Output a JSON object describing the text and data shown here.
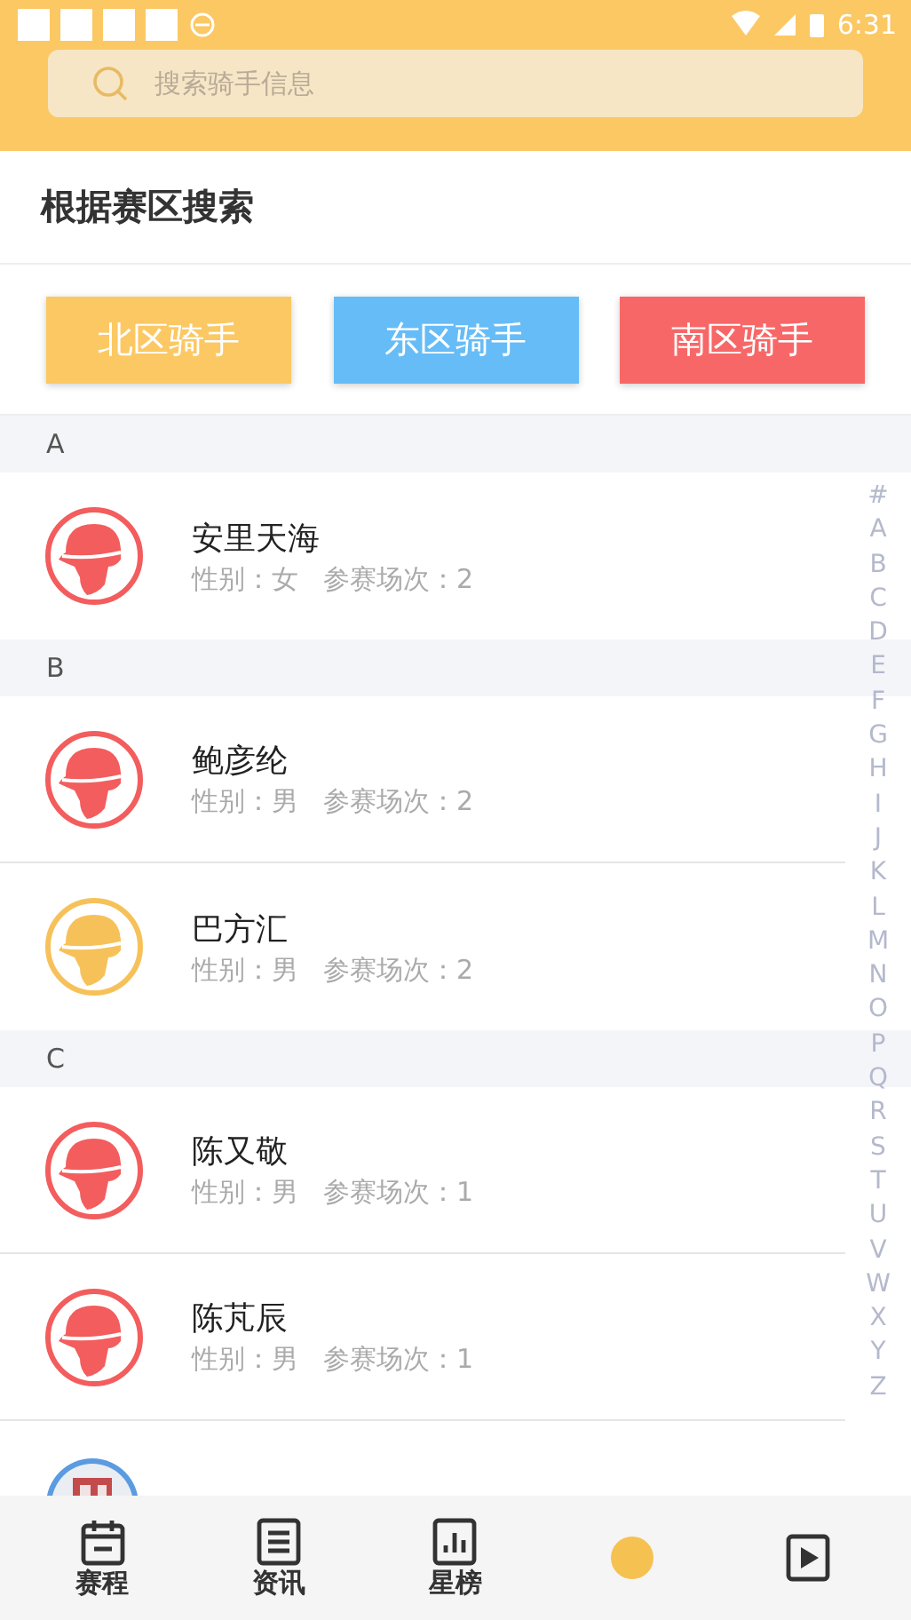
{
  "status_bar": {
    "time": "6:31"
  },
  "search": {
    "placeholder": "搜索骑手信息"
  },
  "section_title": "根据赛区搜索",
  "region_buttons": [
    {
      "label": "北区骑手",
      "color": "#fbc863"
    },
    {
      "label": "东区骑手",
      "color": "#66bcf7"
    },
    {
      "label": "南区骑手",
      "color": "#f86767"
    }
  ],
  "groups": [
    {
      "letter": "A",
      "riders": [
        {
          "name": "安里天海",
          "gender": "性别：女",
          "matches": "参赛场次：2",
          "color": "#f35d5d"
        }
      ]
    },
    {
      "letter": "B",
      "riders": [
        {
          "name": "鲍彦纶",
          "gender": "性别：男",
          "matches": "参赛场次：2",
          "color": "#f35d5d"
        },
        {
          "name": "巴方汇",
          "gender": "性别：男",
          "matches": "参赛场次：2",
          "color": "#f7c15a"
        }
      ]
    },
    {
      "letter": "C",
      "riders": [
        {
          "name": "陈又敬",
          "gender": "性别：男",
          "matches": "参赛场次：1",
          "color": "#f35d5d"
        },
        {
          "name": "陈芃辰",
          "gender": "性别：男",
          "matches": "参赛场次：1",
          "color": "#f35d5d"
        },
        {
          "kind": "picture"
        }
      ]
    }
  ],
  "index_letters": [
    "#",
    "A",
    "B",
    "C",
    "D",
    "E",
    "F",
    "G",
    "H",
    "I",
    "J",
    "K",
    "L",
    "M",
    "N",
    "O",
    "P",
    "Q",
    "R",
    "S",
    "T",
    "U",
    "V",
    "W",
    "X",
    "Y",
    "Z"
  ],
  "tabs": [
    {
      "label": "赛程",
      "kind": "calendar"
    },
    {
      "label": "资讯",
      "kind": "list"
    },
    {
      "label": "星榜",
      "kind": "chart"
    },
    {
      "kind": "sun"
    },
    {
      "kind": "play"
    }
  ]
}
